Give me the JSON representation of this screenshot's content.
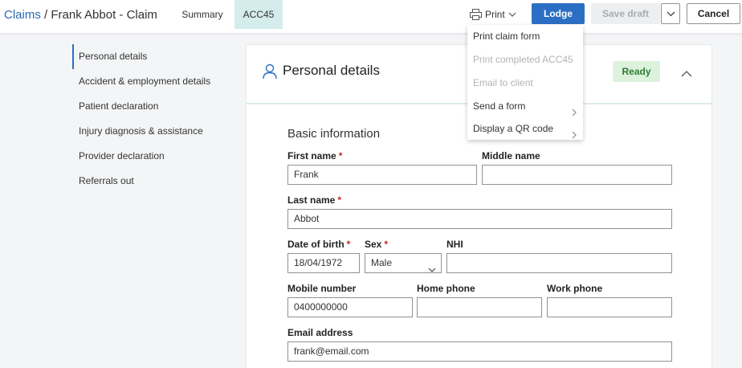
{
  "breadcrumb": {
    "parent": "Claims",
    "separator": "/",
    "current": "Frank Abbot - Claim"
  },
  "tabs": [
    {
      "label": "Summary"
    },
    {
      "label": "ACC45",
      "active": true
    }
  ],
  "toolbar": {
    "print_label": "Print",
    "lodge_label": "Lodge",
    "save_draft_label": "Save draft",
    "cancel_label": "Cancel"
  },
  "print_menu": {
    "items": [
      {
        "label": "Print claim form",
        "disabled": false,
        "has_submenu": false
      },
      {
        "label": "Print completed ACC45",
        "disabled": true,
        "has_submenu": false
      },
      {
        "label": "Email to client",
        "disabled": true,
        "has_submenu": false
      },
      {
        "label": "Send a form",
        "disabled": false,
        "has_submenu": true
      },
      {
        "label": "Display a QR code",
        "disabled": false,
        "has_submenu": true
      }
    ]
  },
  "sidenav": {
    "items": [
      {
        "label": "Personal details",
        "active": true
      },
      {
        "label": "Accident & employment details"
      },
      {
        "label": "Patient declaration"
      },
      {
        "label": "Injury diagnosis & assistance"
      },
      {
        "label": "Provider declaration"
      },
      {
        "label": "Referrals out"
      }
    ]
  },
  "card": {
    "title": "Personal details",
    "status_badge": "Ready",
    "section_title": "Basic information"
  },
  "form": {
    "first_name": {
      "label": "First name",
      "required": "*",
      "value": "Frank"
    },
    "middle_name": {
      "label": "Middle name",
      "value": ""
    },
    "last_name": {
      "label": "Last name",
      "required": "*",
      "value": "Abbot"
    },
    "dob": {
      "label": "Date of birth",
      "required": "*",
      "value": "18/04/1972"
    },
    "sex": {
      "label": "Sex",
      "required": "*",
      "value": "Male"
    },
    "nhi": {
      "label": "NHI",
      "value": ""
    },
    "mobile": {
      "label": "Mobile number",
      "value": "0400000000"
    },
    "home_phone": {
      "label": "Home phone",
      "value": ""
    },
    "work_phone": {
      "label": "Work phone",
      "value": ""
    },
    "email": {
      "label": "Email address",
      "value": "frank@email.com"
    }
  },
  "colors": {
    "accent": "#2b6fc4",
    "active_tab_bg": "#d4ecec",
    "ready_bg": "#ddf2dc",
    "ready_text": "#2d7d32",
    "required": "#c62828"
  },
  "icons": {
    "print": "printer-icon",
    "person": "person-icon",
    "collapse": "chevron-up-icon",
    "dropdown": "chevron-down-icon",
    "submenu": "chevron-right-icon"
  }
}
